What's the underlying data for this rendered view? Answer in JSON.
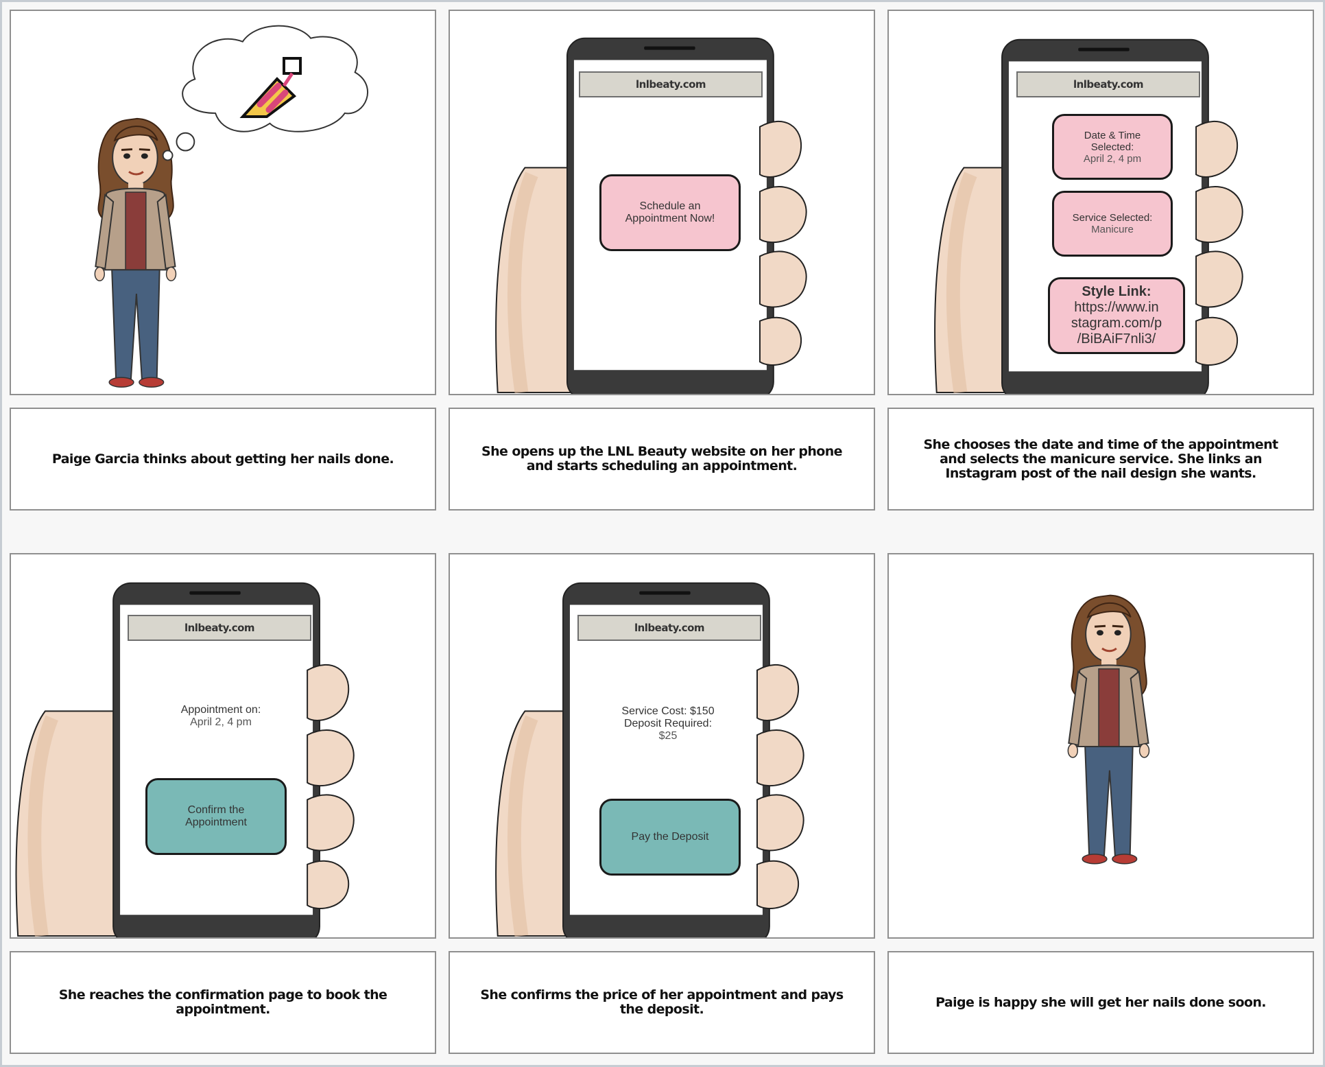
{
  "panels": [
    {
      "caption": "Paige Garcia thinks about getting her nails done."
    },
    {
      "url": "lnlbeaty.com",
      "button_line1": "Schedule an",
      "button_line2": "Appointment Now!",
      "caption": "She opens up the LNL Beauty website on her phone and starts scheduling an appointment."
    },
    {
      "url": "lnlbeaty.com",
      "date_title": "Date & Time",
      "date_title2": "Selected:",
      "date_value": "April 2, 4 pm",
      "service_title": "Service Selected:",
      "service_value": "Manicure",
      "style_title": "Style Link:",
      "style_line1": "https://www.in",
      "style_line2": "stagram.com/p",
      "style_line3": "/BiBAiF7nli3/",
      "caption": "She chooses the date and time of the appointment and selects the manicure service. She links an Instagram post of the nail design she wants."
    },
    {
      "url": "lnlbeaty.com",
      "appt_title": "Appointment on:",
      "appt_value": "April 2, 4 pm",
      "button_line1": "Confirm the",
      "button_line2": "Appointment",
      "caption": "She reaches the confirmation page to book the appointment."
    },
    {
      "url": "lnlbeaty.com",
      "cost_line": "Service Cost: $150",
      "deposit_line": "Deposit Required:",
      "deposit_value": "$25",
      "button_label": "Pay the Deposit",
      "caption": "She confirms the price of her appointment and pays the deposit."
    },
    {
      "caption": "Paige is happy she will get her nails done soon."
    }
  ],
  "colors": {
    "pink_button": "#f6c5cf",
    "teal_button": "#7ab9b6",
    "url_bar": "#d8d6cd",
    "phone_body": "#3a3a3a",
    "skin": "#f1d9c6"
  },
  "icons": {
    "thought": "nail-polish-icon"
  }
}
